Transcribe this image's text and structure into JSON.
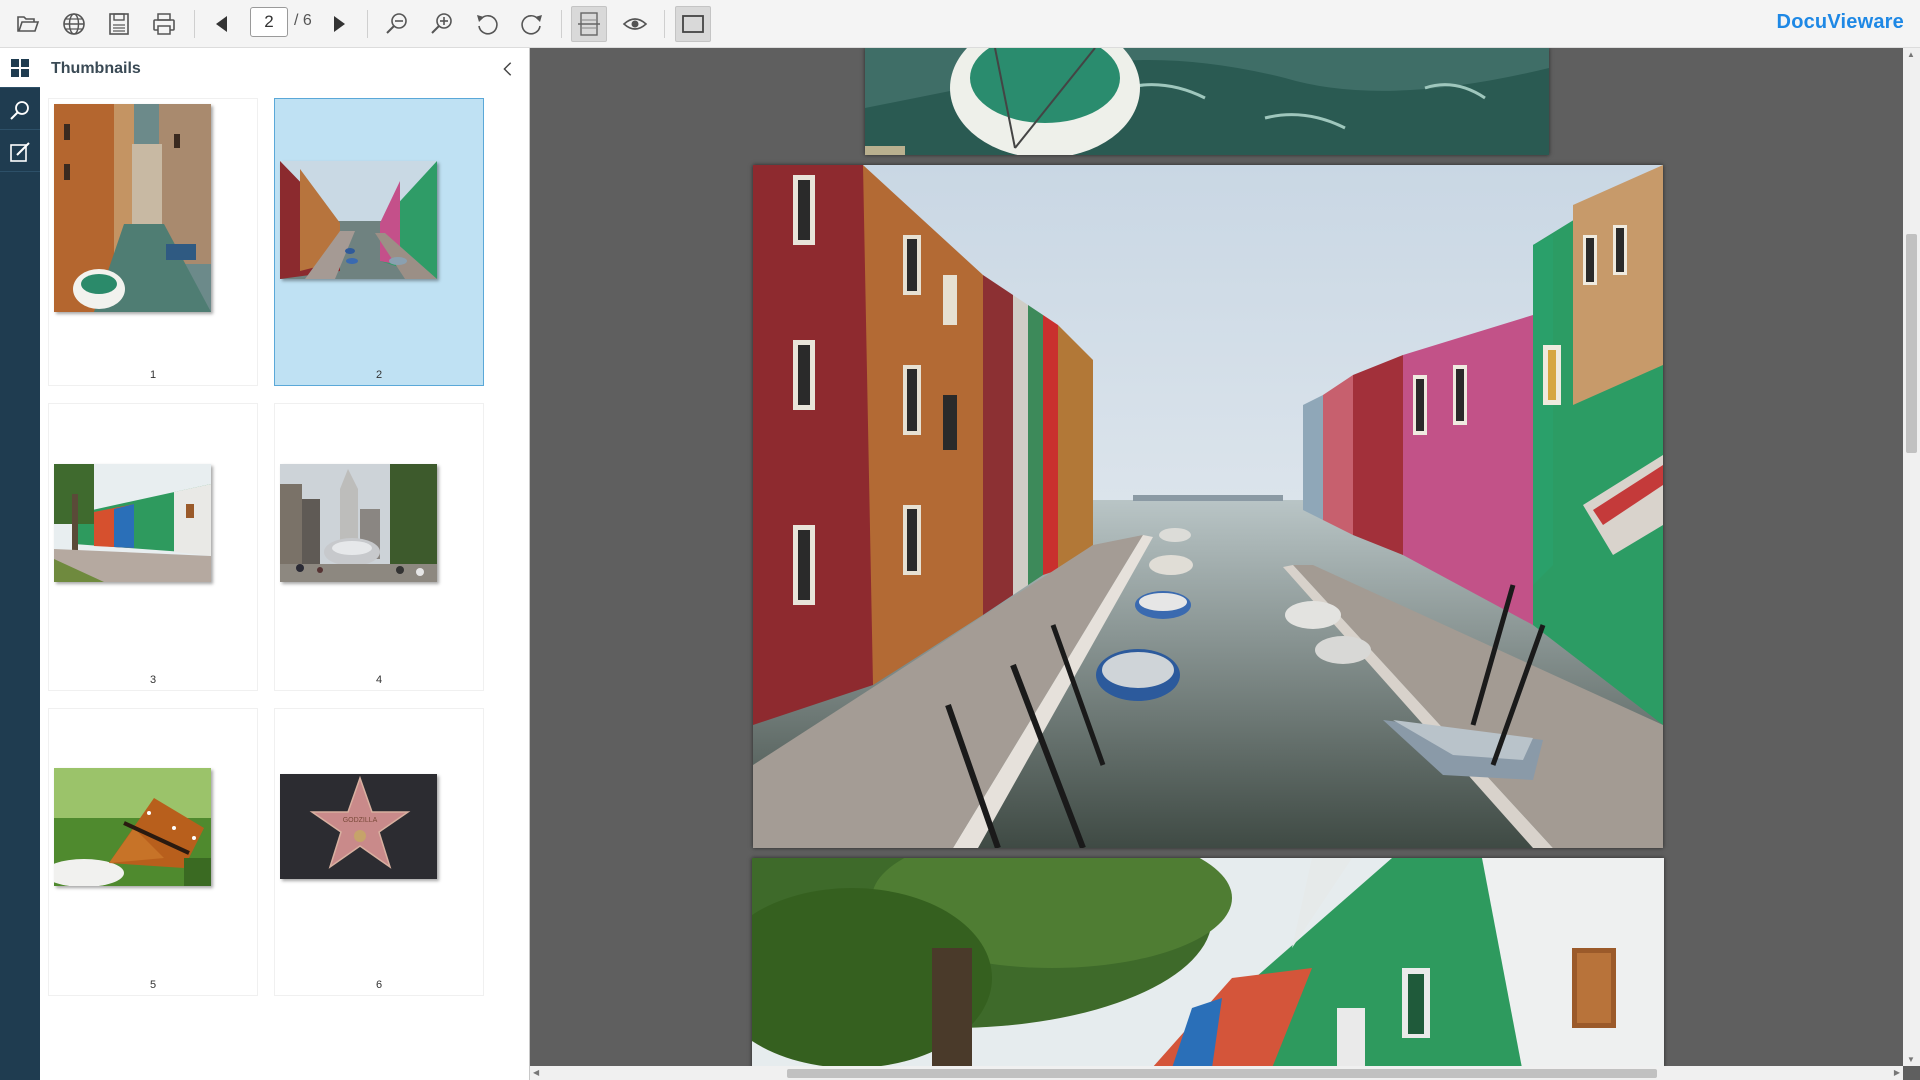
{
  "app": {
    "logo_text": "DocuVieware"
  },
  "toolbar": {
    "buttons": [
      {
        "id": "open",
        "icon": "folder-open-icon"
      },
      {
        "id": "web",
        "icon": "globe-icon"
      },
      {
        "id": "save",
        "icon": "save-icon"
      },
      {
        "id": "print",
        "icon": "print-icon"
      },
      {
        "id": "prev",
        "icon": "previous-page-icon"
      },
      {
        "id": "next",
        "icon": "next-page-icon"
      },
      {
        "id": "zoom-out",
        "icon": "zoom-out-icon"
      },
      {
        "id": "zoom-in",
        "icon": "zoom-in-icon"
      },
      {
        "id": "rotate-left",
        "icon": "rotate-left-icon"
      },
      {
        "id": "rotate-right",
        "icon": "rotate-right-icon"
      },
      {
        "id": "fit-width",
        "icon": "fit-width-icon"
      },
      {
        "id": "view-mode",
        "icon": "eye-icon"
      },
      {
        "id": "single-page",
        "icon": "single-page-icon"
      }
    ],
    "current_page": "2",
    "page_total": "/ 6"
  },
  "rail": {
    "items": [
      {
        "id": "thumbnails",
        "icon": "thumbnails-grid-icon",
        "active": true
      },
      {
        "id": "search",
        "icon": "search-icon",
        "active": false
      },
      {
        "id": "annotate",
        "icon": "annotate-icon",
        "active": false
      }
    ]
  },
  "thumbnails_panel": {
    "title": "Thumbnails",
    "items": [
      {
        "number": "1",
        "selected": false,
        "subject": "venice-canal"
      },
      {
        "number": "2",
        "selected": true,
        "subject": "burano-canal"
      },
      {
        "number": "3",
        "selected": false,
        "subject": "colorful-houses"
      },
      {
        "number": "4",
        "selected": false,
        "subject": "city-bean"
      },
      {
        "number": "5",
        "selected": false,
        "subject": "butterfly"
      },
      {
        "number": "6",
        "selected": false,
        "subject": "walk-of-fame-star",
        "star_text": "GODZILLA"
      }
    ]
  },
  "viewer": {
    "current_page": 2,
    "pages_visible": [
      "1",
      "2",
      "3"
    ]
  },
  "colors": {
    "toolbar_bg": "#f4f4f4",
    "rail_bg": "#1f3c50",
    "viewer_bg": "#5f5f5f",
    "selected_thumb": "#bfe1f3",
    "logo": "#1e88e5"
  }
}
